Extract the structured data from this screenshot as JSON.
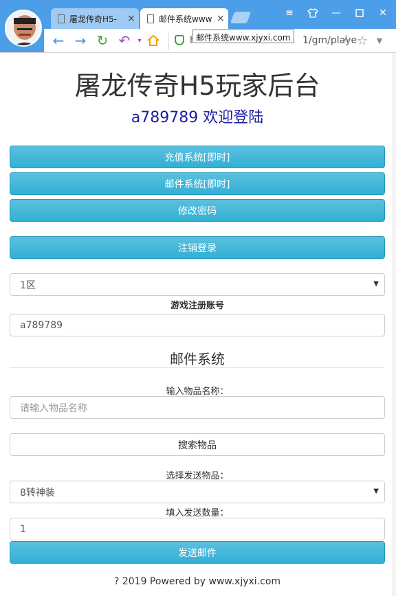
{
  "browser": {
    "tabs": [
      {
        "label": "屠龙传奇H5-"
      },
      {
        "label": "邮件系统www"
      }
    ],
    "url_partial": "h",
    "url_tail": "1/gm/playe",
    "tooltip": "邮件系统www.xjyxi.com"
  },
  "page": {
    "title": "屠龙传奇H5玩家后台",
    "welcome": "a789789 欢迎登陆",
    "buttons": {
      "recharge": "充值系统[即时]",
      "mail": "邮件系统[即时]",
      "change_password": "修改密码",
      "logout": "注销登录"
    },
    "server_select": "1区",
    "account_label": "游戏注册账号",
    "account_value": "a789789",
    "section_title": "邮件系统",
    "item_name_label": "输入物品名称：",
    "item_name_placeholder": "请输入物品名称",
    "search_button": "搜索物品",
    "send_item_label": "选择发送物品：",
    "send_item_value": "8转神装",
    "quantity_label": "填入发送数量：",
    "quantity_value": "1",
    "send_button": "发送邮件",
    "footer": "? 2019 Powered by www.xjyxi.com"
  },
  "colors": {
    "browser_accent": "#4c9ee8",
    "info_button": "#31b0d5",
    "welcome_text": "#1a1aa8"
  },
  "icons": [
    "avatar",
    "document-icon",
    "close-icon",
    "new-tab-icon",
    "menu-icon",
    "skin-icon",
    "minimize-icon",
    "maximize-icon",
    "window-close-icon",
    "back-icon",
    "forward-icon",
    "reload-icon",
    "undo-icon",
    "home-icon",
    "shield-icon",
    "lightning-icon",
    "star-icon",
    "chevron-down-icon"
  ]
}
